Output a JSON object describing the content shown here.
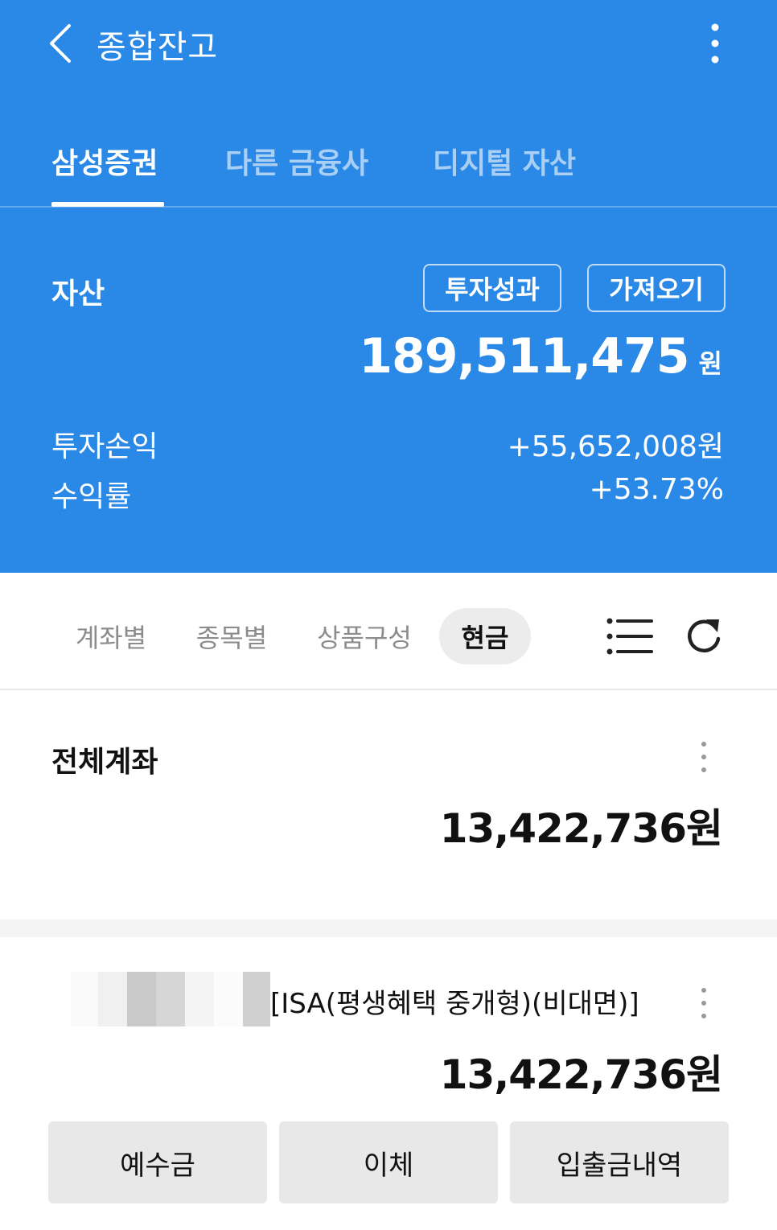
{
  "header": {
    "title": "종합잔고",
    "back_icon": "chevron-left-icon",
    "more_icon": "more-vertical-icon"
  },
  "tabs": [
    {
      "label": "삼성증권",
      "active": true
    },
    {
      "label": "다른 금융사",
      "active": false
    },
    {
      "label": "디지털 자산",
      "active": false
    }
  ],
  "summary": {
    "asset_label": "자산",
    "performance_button": "투자성과",
    "import_button": "가져오기",
    "asset_amount": "189,511,475",
    "asset_unit": "원",
    "profit_label": "투자손익",
    "profit_value": "+55,652,008원",
    "return_label": "수익률",
    "return_value": "+53.73%"
  },
  "segments": [
    {
      "label": "계좌별",
      "active": false
    },
    {
      "label": "종목별",
      "active": false
    },
    {
      "label": "상품구성",
      "active": false
    },
    {
      "label": "현금",
      "active": true
    }
  ],
  "toolbar": {
    "list_icon": "list-icon",
    "refresh_icon": "refresh-icon"
  },
  "total_account": {
    "label": "전체계좌",
    "amount": "13,422,736원"
  },
  "account": {
    "name": "[ISA(평생혜택 중개형)(비대면)]",
    "amount": "13,422,736원"
  },
  "actions": [
    {
      "label": "예수금"
    },
    {
      "label": "이체"
    },
    {
      "label": "입출금내역"
    }
  ],
  "colors": {
    "brand_blue": "#2a88e6",
    "segment_active_bg": "#ececec",
    "action_button_bg": "#e8e8e8"
  }
}
